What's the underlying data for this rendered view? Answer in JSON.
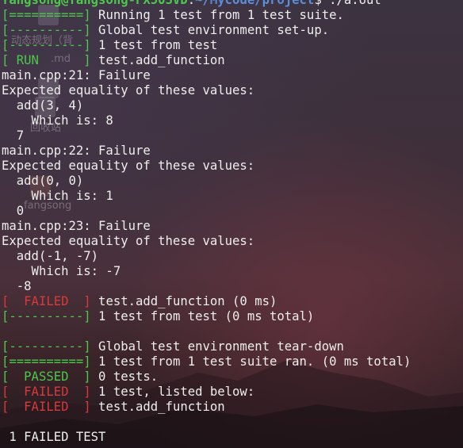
{
  "prompt": {
    "user_host": "fangsong@fangsong-FX503VD",
    "path": "~/Mycode/project",
    "dollar": "$",
    "command": " ./a.out"
  },
  "desktop": {
    "folder_label": "动态规划（背",
    "file_label": ".md",
    "icon3_label": "回收站",
    "icon4_label": "fangsong"
  },
  "lines": [
    {
      "tag": "[==========]",
      "color": "green",
      "text": " Running 1 test from 1 test suite."
    },
    {
      "tag": "[----------]",
      "color": "green",
      "text": " Global test environment set-up."
    },
    {
      "tag": "[----------]",
      "color": "green",
      "text": " 1 test from test"
    },
    {
      "tag": "[ RUN      ]",
      "color": "green",
      "text": " test.add_function"
    },
    {
      "tag": "",
      "color": "",
      "text": "main.cpp:21: Failure"
    },
    {
      "tag": "",
      "color": "",
      "text": "Expected equality of these values:"
    },
    {
      "tag": "",
      "color": "",
      "text": "  add(3, 4)"
    },
    {
      "tag": "",
      "color": "",
      "text": "    Which is: 8"
    },
    {
      "tag": "",
      "color": "",
      "text": "  7"
    },
    {
      "tag": "",
      "color": "",
      "text": "main.cpp:22: Failure"
    },
    {
      "tag": "",
      "color": "",
      "text": "Expected equality of these values:"
    },
    {
      "tag": "",
      "color": "",
      "text": "  add(0, 0)"
    },
    {
      "tag": "",
      "color": "",
      "text": "    Which is: 1"
    },
    {
      "tag": "",
      "color": "",
      "text": "  0"
    },
    {
      "tag": "",
      "color": "",
      "text": "main.cpp:23: Failure"
    },
    {
      "tag": "",
      "color": "",
      "text": "Expected equality of these values:"
    },
    {
      "tag": "",
      "color": "",
      "text": "  add(-1, -7)"
    },
    {
      "tag": "",
      "color": "",
      "text": "    Which is: -7"
    },
    {
      "tag": "",
      "color": "",
      "text": "  -8"
    },
    {
      "tag": "[  FAILED  ]",
      "color": "red",
      "text": " test.add_function (0 ms)"
    },
    {
      "tag": "[----------]",
      "color": "green",
      "text": " 1 test from test (0 ms total)"
    },
    {
      "tag": "",
      "color": "",
      "text": ""
    },
    {
      "tag": "[----------]",
      "color": "green",
      "text": " Global test environment tear-down"
    },
    {
      "tag": "[==========]",
      "color": "green",
      "text": " 1 test from 1 test suite ran. (0 ms total)"
    },
    {
      "tag": "[  PASSED  ]",
      "color": "green",
      "text": " 0 tests."
    },
    {
      "tag": "[  FAILED  ]",
      "color": "red",
      "text": " 1 test, listed below:"
    },
    {
      "tag": "[  FAILED  ]",
      "color": "red",
      "text": " test.add_function"
    },
    {
      "tag": "",
      "color": "",
      "text": ""
    },
    {
      "tag": "",
      "color": "",
      "text": " 1 FAILED TEST"
    }
  ],
  "colors": {
    "green": "#4cc84a",
    "red": "#d63a3a",
    "text": "#eeeeec",
    "path": "#5b8fd8"
  }
}
